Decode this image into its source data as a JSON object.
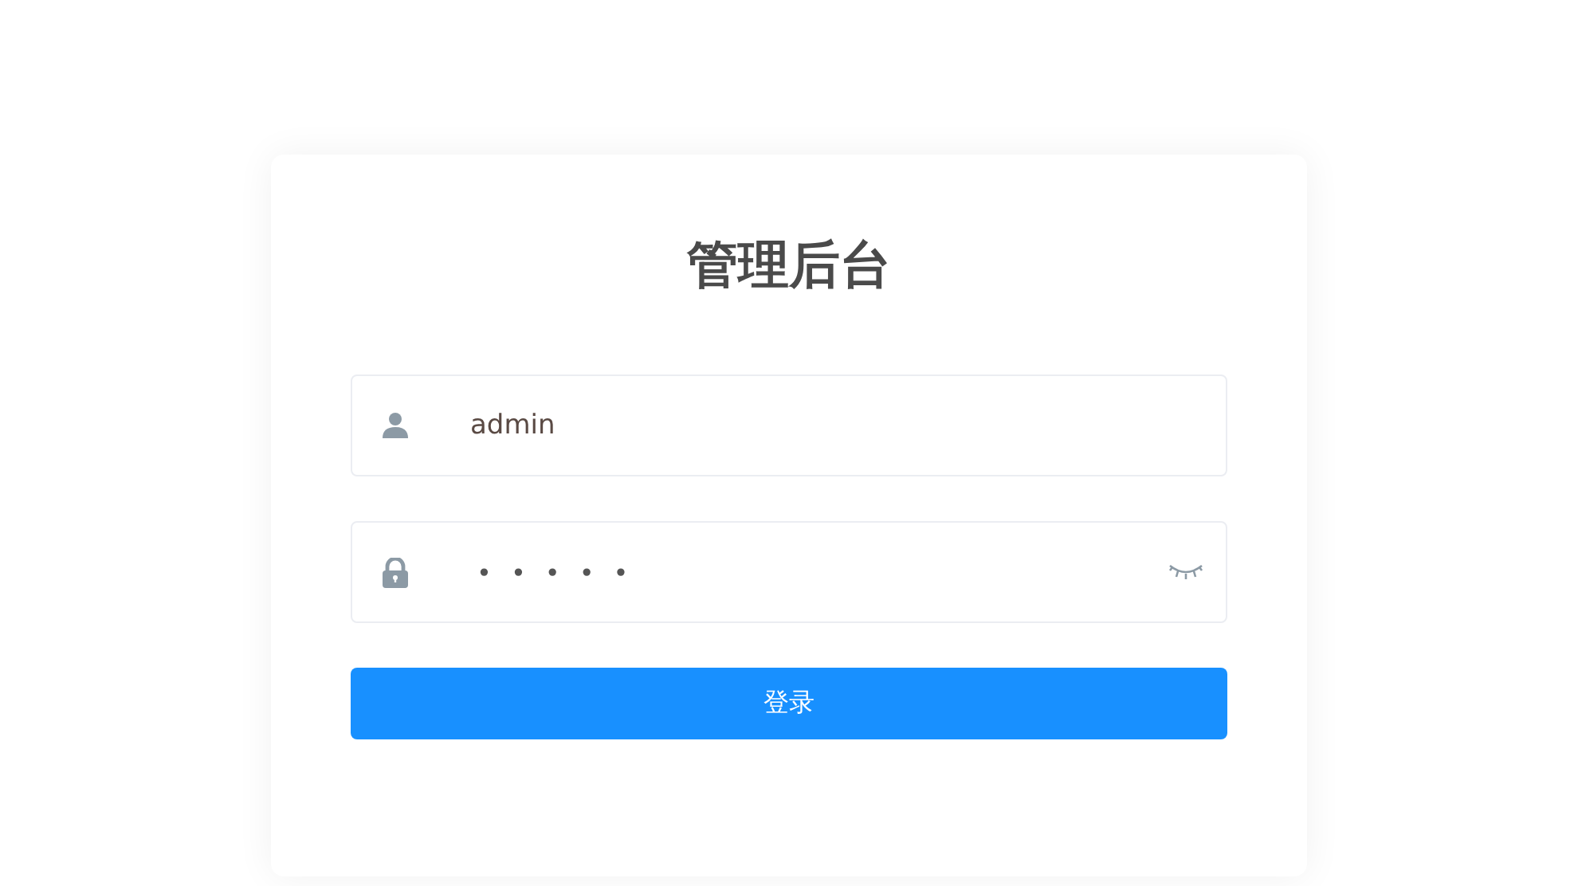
{
  "title": "管理后台",
  "username": {
    "value": "admin"
  },
  "password": {
    "masked_value": "•••••",
    "visible": false
  },
  "login_button": {
    "label": "登录"
  }
}
